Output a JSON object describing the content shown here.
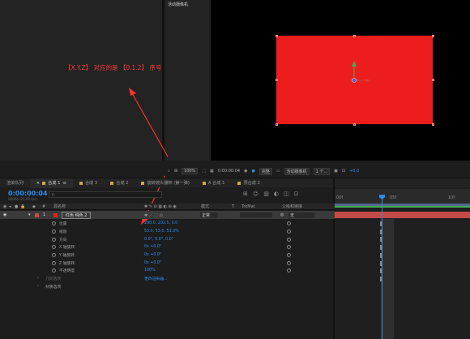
{
  "composition_panel": {
    "header": "活动摄像机"
  },
  "annotation": "【X.Y.Z】 对应的是 【0.1.2】 序号",
  "viewer_toolbar": {
    "zoom": "100%",
    "timecode": "0:00:00:04",
    "quality": "完整",
    "camera": "活动摄像机",
    "views": "1 个...",
    "exposure": "+0.0"
  },
  "tabs": [
    {
      "label": "渲染队列"
    },
    {
      "label": "合成 1"
    },
    {
      "label": "合成 3"
    },
    {
      "label": "合成 2"
    },
    {
      "label": "旋转镜头摆钟 (第一弹)"
    },
    {
      "label": "A 合成 1"
    },
    {
      "label": "预合成 2"
    }
  ],
  "timeline": {
    "timecode": "0:00:00:04",
    "timecode_sub": "00004 (25.00 fps)",
    "search_placeholder": "ρ.",
    "ruler_ticks": [
      "00f",
      "05f",
      "10f"
    ],
    "columns": {
      "source_name": "源名称",
      "mode": "模式",
      "t": "T",
      "trkmat": "TrkMat",
      "parent": "父级和链接"
    }
  },
  "layer": {
    "number": "1",
    "name": "红色 纯色 2",
    "mode": "正常",
    "parent": "无",
    "color": "#ee1d1d"
  },
  "properties": [
    {
      "name": "位置",
      "value": "290.0, 202.5, 0.0"
    },
    {
      "name": "缩放",
      "value": "53.0, 53.0, 53.0%"
    },
    {
      "name": "方向",
      "value": "0.0°, 0.0°, 0.0°"
    },
    {
      "name": "X 轴旋转",
      "value": "0x +0.0°"
    },
    {
      "name": "Y 轴旋转",
      "value": "0x +0.0°"
    },
    {
      "name": "Z 轴旋转",
      "value": "0x +0.0°"
    },
    {
      "name": "不透明度",
      "value": "100%"
    }
  ],
  "groups": [
    {
      "name": "几何选项",
      "value": "更改渲染器..."
    },
    {
      "name": "材质选项",
      "value": ""
    }
  ]
}
